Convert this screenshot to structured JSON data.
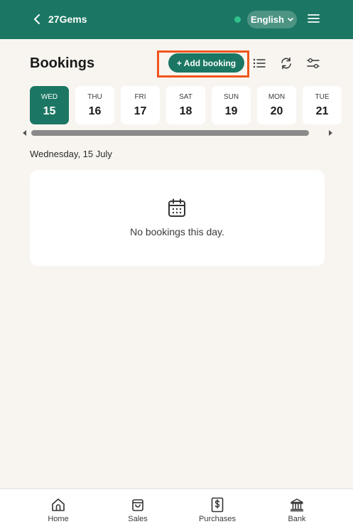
{
  "header": {
    "app_name": "27Gems",
    "language": "English",
    "icons": {
      "back": "chevron-left-icon",
      "menu": "hamburger-menu-icon",
      "status": "online-status-dot"
    }
  },
  "page": {
    "title": "Bookings",
    "add_booking_label": "+ Add booking",
    "tools": [
      "list-view-icon",
      "refresh-icon",
      "filter-sliders-icon"
    ]
  },
  "days": [
    {
      "name": "WED",
      "num": "15",
      "active": true
    },
    {
      "name": "THU",
      "num": "16",
      "active": false
    },
    {
      "name": "FRI",
      "num": "17",
      "active": false
    },
    {
      "name": "SAT",
      "num": "18",
      "active": false
    },
    {
      "name": "SUN",
      "num": "19",
      "active": false
    },
    {
      "name": "MON",
      "num": "20",
      "active": false
    },
    {
      "name": "TUE",
      "num": "21",
      "active": false
    }
  ],
  "selected_date_label": "Wednesday, 15 July",
  "empty_state": {
    "icon": "calendar-icon",
    "text": "No bookings this day."
  },
  "bottom_nav": [
    {
      "label": "Home",
      "icon": "home-icon"
    },
    {
      "label": "Sales",
      "icon": "shopping-bag-icon"
    },
    {
      "label": "Purchases",
      "icon": "receipt-dollar-icon"
    },
    {
      "label": "Bank",
      "icon": "bank-icon"
    }
  ],
  "colors": {
    "brand": "#1b7763",
    "highlight": "#f0561c",
    "background": "#f8f5f0"
  }
}
